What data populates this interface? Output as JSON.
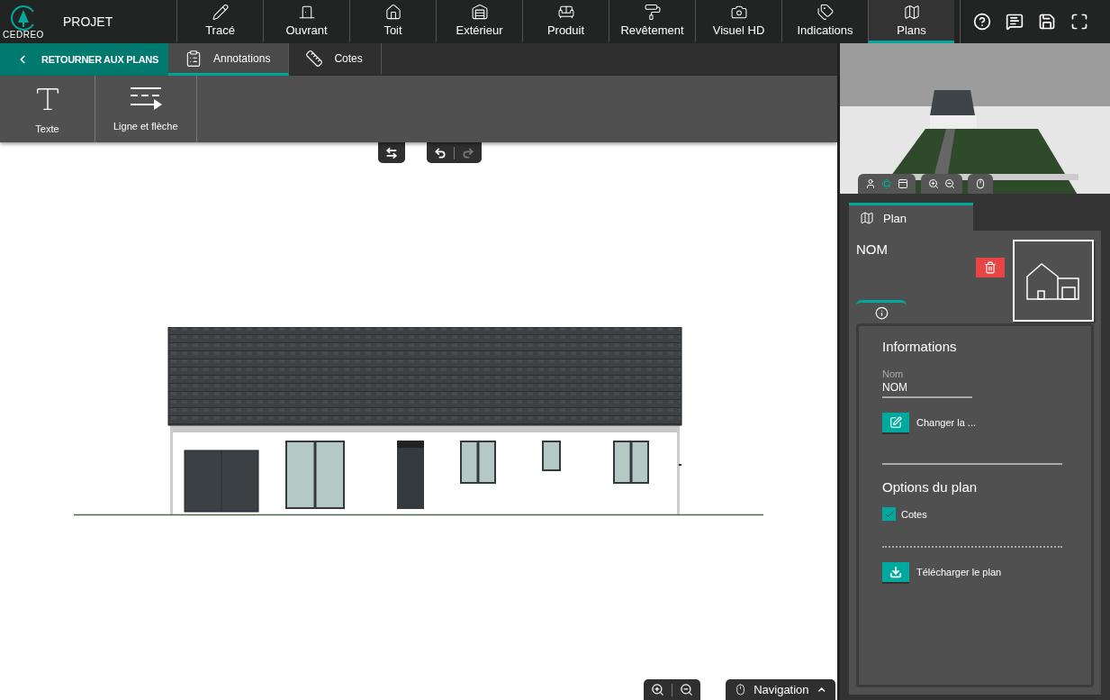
{
  "app": {
    "logo_text": "CEDREO",
    "project_label": "PROJET"
  },
  "main_menu": [
    {
      "label": "Tracé",
      "selected": false
    },
    {
      "label": "Ouvrant",
      "selected": false
    },
    {
      "label": "Toit",
      "selected": false
    },
    {
      "label": "Extérieur",
      "selected": false
    },
    {
      "label": "Produit",
      "selected": false
    },
    {
      "label": "Revêtement",
      "selected": false
    },
    {
      "label": "Visuel HD",
      "selected": false
    },
    {
      "label": "Indications",
      "selected": false
    },
    {
      "label": "Plans",
      "selected": true
    }
  ],
  "back_button": {
    "label": "RETOURNER AUX PLANS"
  },
  "sub_tabs": [
    {
      "label": "Annotations",
      "selected": true
    },
    {
      "label": "Cotes",
      "selected": false
    }
  ],
  "tools": [
    {
      "label": "Texte"
    },
    {
      "label": "Ligne et flèche"
    }
  ],
  "history": {
    "undo_disabled": false,
    "redo_disabled": true
  },
  "navigation": {
    "label": "Navigation"
  },
  "panel": {
    "tab": "Plan",
    "name": "NOM",
    "section_title": "Informations",
    "field_label": "Nom",
    "field_value": "NOM",
    "change_button": "Changer la ...",
    "options_title": "Options du plan",
    "options": [
      {
        "label": "Cotes",
        "checked": true
      }
    ],
    "download_button": "Télécharger le plan"
  }
}
